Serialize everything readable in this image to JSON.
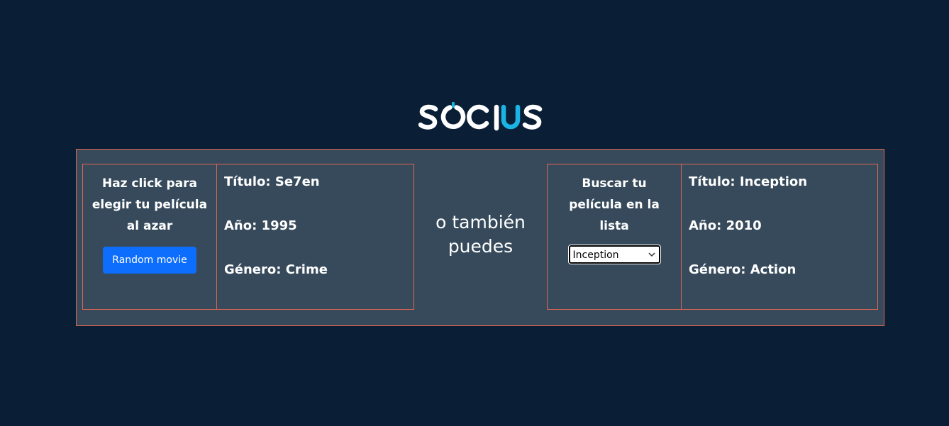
{
  "brand": {
    "name": "SOCIUS",
    "accent_color": "#1ab3e6"
  },
  "left_panel": {
    "prompt": "Haz click para elegir tu película al azar",
    "button_label": "Random movie",
    "movie": {
      "title": "Título: Se7en",
      "year": "Año: 1995",
      "genre": "Género: Crime"
    }
  },
  "middle_text": "o también puedes",
  "right_panel": {
    "prompt": "Buscar tu película en la lista",
    "select_value": "Inception",
    "movie": {
      "title": "Título: Inception",
      "year": "Año: 2010",
      "genre": "Género: Action"
    }
  },
  "colors": {
    "background": "#0a1f35",
    "card": "#364a5b",
    "border": "#e06652",
    "button": "#0d6efd"
  }
}
